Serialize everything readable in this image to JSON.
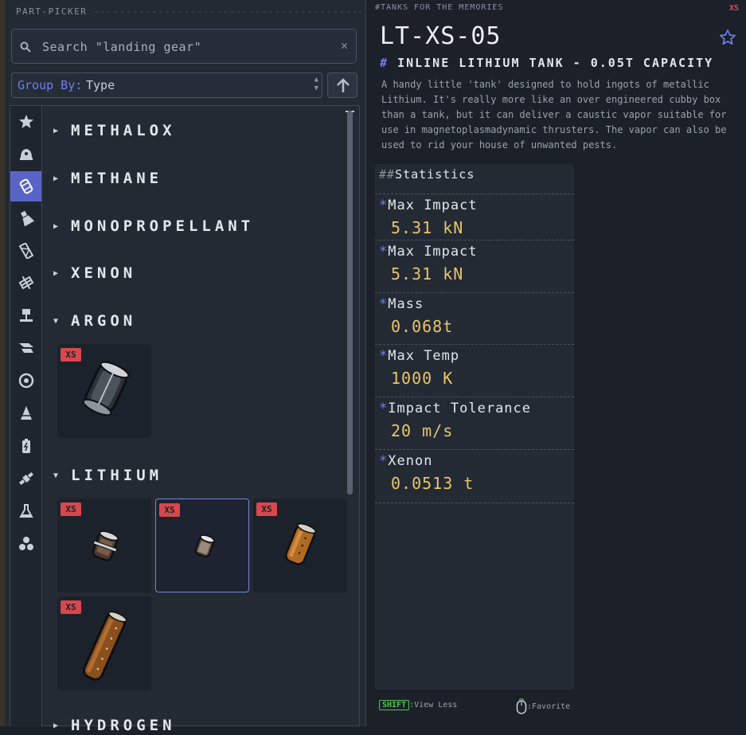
{
  "picker": {
    "header": "PART-PICKER",
    "search_placeholder": "Search \"landing gear\"",
    "group_by_label": "Group By:",
    "group_by_value": "Type"
  },
  "categories": [
    {
      "icon": "star-icon",
      "active": false
    },
    {
      "icon": "capsule-icon",
      "active": false
    },
    {
      "icon": "fuel-tank-icon",
      "active": true
    },
    {
      "icon": "engine-icon",
      "active": false
    },
    {
      "icon": "structural-icon",
      "active": false
    },
    {
      "icon": "coupling-icon",
      "active": false
    },
    {
      "icon": "landing-gear-icon",
      "active": false
    },
    {
      "icon": "wing-icon",
      "active": false
    },
    {
      "icon": "wheel-icon",
      "active": false
    },
    {
      "icon": "nosecone-icon",
      "active": false
    },
    {
      "icon": "battery-icon",
      "active": false
    },
    {
      "icon": "satellite-icon",
      "active": false
    },
    {
      "icon": "science-flask-icon",
      "active": false
    },
    {
      "icon": "resource-icon",
      "active": false
    }
  ],
  "groups": [
    {
      "name": "METHALOX",
      "expanded": false
    },
    {
      "name": "METHANE",
      "expanded": false
    },
    {
      "name": "MONOPROPELLANT",
      "expanded": false
    },
    {
      "name": "XENON",
      "expanded": false
    },
    {
      "name": "ARGON",
      "expanded": true
    },
    {
      "name": "LITHIUM",
      "expanded": true
    },
    {
      "name": "HYDROGEN",
      "expanded": false
    }
  ],
  "size_badge": "XS",
  "detail": {
    "header": "#TANKS FOR THE MEMORIES",
    "size_badge": "XS",
    "part_id": "LT-XS-05",
    "part_name_hash": "#",
    "part_name": "INLINE LITHIUM TANK - 0.05T CAPACITY",
    "description": "A handy little 'tank' designed to hold ingots of metallic Lithium. It's really more like an over engineered cubby box than a tank, but it can deliver a caustic vapor suitable for use in magnetoplasmadynamic thrusters. The vapor can also be used to rid your house of unwanted pests.",
    "stats_hash": "##",
    "stats_title": "Statistics",
    "stats": [
      {
        "name": "Max Impact",
        "value": "5.31 kN"
      },
      {
        "name": "Max Impact",
        "value": "5.31 kN"
      },
      {
        "name": "Mass",
        "value": "0.068t"
      },
      {
        "name": "Max Temp",
        "value": "1000 K"
      },
      {
        "name": "Impact Tolerance",
        "value": "20 m/s"
      },
      {
        "name": "Xenon",
        "value": "0.0513 t"
      }
    ],
    "stat_marker": "*"
  },
  "hints": {
    "shift_key": "SHIFT",
    "shift_action": ":View Less",
    "mouse_action": ":Favorite"
  },
  "colors": {
    "accent": "#6f7ef0",
    "value": "#e9c46a",
    "badge": "#d7484e"
  }
}
